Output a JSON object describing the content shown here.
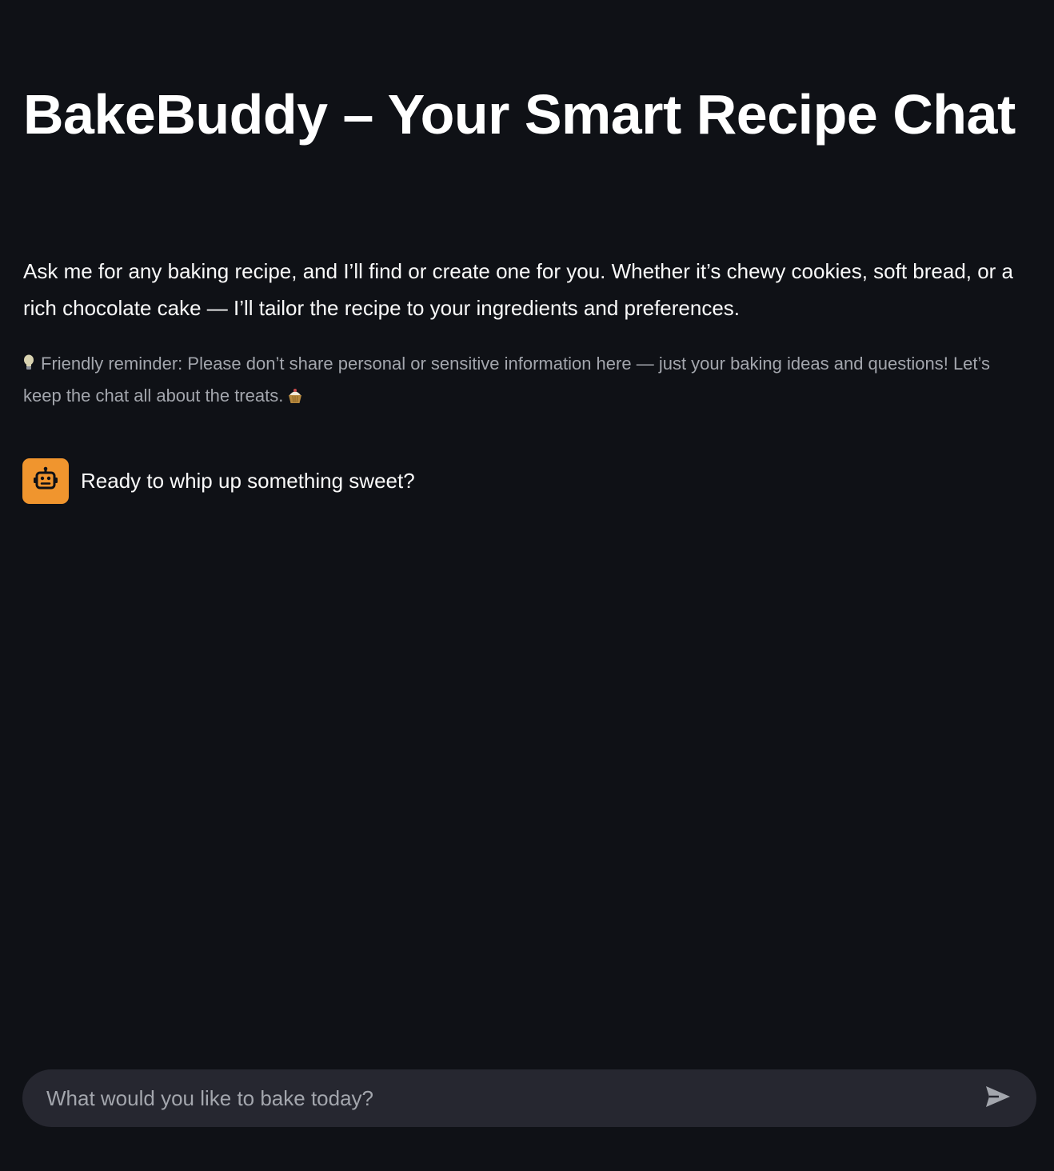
{
  "page": {
    "title": "BakeBuddy – Your Smart Recipe Chat",
    "intro": "Ask me for any baking recipe, and I’ll find or create one for you. Whether it’s chewy cookies, soft bread, or a rich chocolate cake — I’ll tailor the recipe to your ingredients and preferences.",
    "reminder": "Friendly reminder: Please don’t share personal or sensitive information here — just your baking ideas and questions! Let’s keep the chat all about the treats.",
    "reminder_icon_start": "lightbulb-icon",
    "reminder_icon_end": "cupcake-icon"
  },
  "messages": [
    {
      "role": "assistant",
      "avatar_icon": "robot-icon",
      "avatar_color": "#f0952e",
      "text": "Ready to whip up something sweet?"
    }
  ],
  "chat_input": {
    "placeholder": "What would you like to bake today?",
    "value": "",
    "send_icon": "send-icon"
  },
  "colors": {
    "background": "#0f1116",
    "input_background": "#262730",
    "muted_text": "#a3a6ad",
    "accent": "#f0952e"
  }
}
